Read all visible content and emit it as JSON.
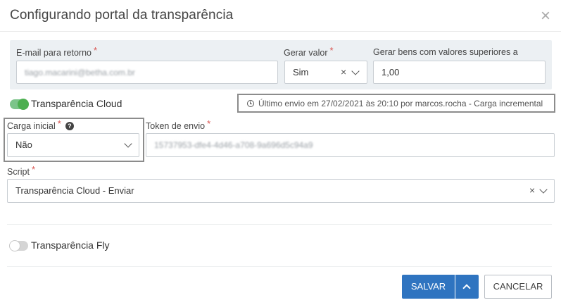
{
  "modal": {
    "title": "Configurando portal da transparência",
    "close_symbol": "×"
  },
  "email": {
    "label": "E-mail para retorno",
    "required": "*",
    "value": "tiago.macarini@betha.com.br"
  },
  "gerar_valor": {
    "label": "Gerar valor",
    "required": "*",
    "value": "Sim",
    "clear_symbol": "×"
  },
  "gerar_bens": {
    "label": "Gerar bens com valores superiores a",
    "value": "1,00"
  },
  "transparencia_cloud": {
    "label": "Transparência Cloud",
    "enabled": true,
    "info": "Último envio em 27/02/2021 às 20:10 por marcos.rocha - Carga incremental"
  },
  "carga_inicial": {
    "label": "Carga inicial",
    "required": "*",
    "help_symbol": "?",
    "value": "Não"
  },
  "token": {
    "label": "Token de envio",
    "required": "*",
    "value": "15737953-dfe4-4d46-a708-9a696d5c94a9"
  },
  "script": {
    "label": "Script",
    "required": "*",
    "value": "Transparência Cloud - Enviar",
    "clear_symbol": "×"
  },
  "transparencia_fly": {
    "label": "Transparência Fly",
    "enabled": false
  },
  "footer": {
    "save_label": "SALVAR",
    "cancel_label": "CANCELAR"
  },
  "colors": {
    "primary": "#2f74c0",
    "toggle_on": "#4caf50",
    "required": "#d9534f",
    "panel_bg": "#ecf0f3"
  },
  "icons": [
    "close-icon",
    "clock-icon",
    "question-circle-icon",
    "chevron-down-icon",
    "chevron-up-icon",
    "clear-icon"
  ]
}
